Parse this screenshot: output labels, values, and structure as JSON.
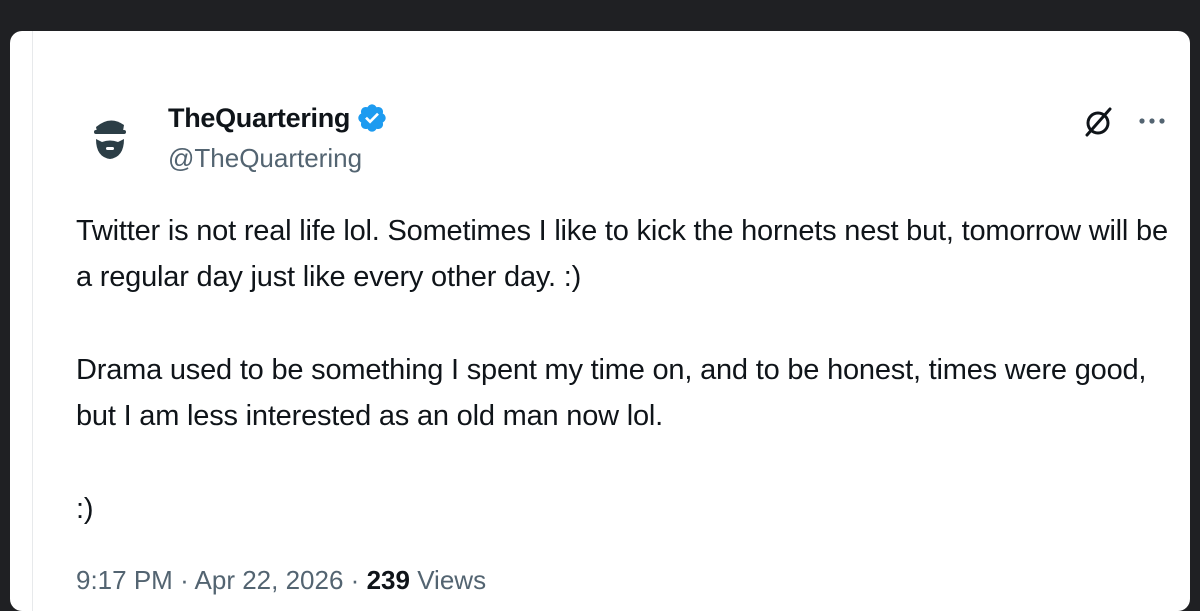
{
  "tweet": {
    "display_name": "TheQuartering",
    "handle": "@TheQuartering",
    "paragraphs": [
      "Twitter is not real life lol.  Sometimes I like to kick the hornets nest but, tomorrow will be a regular day just like every other day. :)",
      "Drama used to be something I spent my time on, and to be honest, times were good, but I am less interested as an old man now lol.",
      ":)"
    ],
    "time": "9:17 PM",
    "separator": "·",
    "date": "Apr 22, 2026",
    "views_count": "239",
    "views_label": "Views"
  },
  "icons": {
    "avatar": "avatar-icon",
    "verified": "verified-badge-icon",
    "grok": "grok-icon",
    "more": "more-options-icon"
  },
  "colors": {
    "background": "#1f2023",
    "card": "#ffffff",
    "text": "#0f1419",
    "secondary_text": "#536471",
    "verified": "#1d9bf0"
  }
}
